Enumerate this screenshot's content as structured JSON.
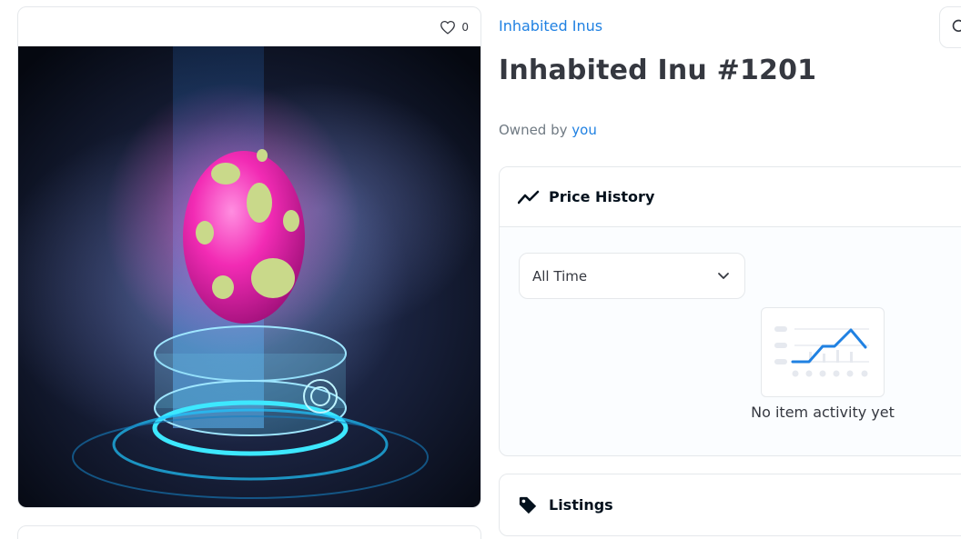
{
  "media": {
    "favorite_count": "0",
    "image_alt": "Pink spotted egg on glowing hologram pedestal"
  },
  "item": {
    "collection_name": "Inhabited Inus",
    "title": "Inhabited Inu #1201",
    "owned_by_prefix": "Owned by",
    "owner": "you"
  },
  "price_history": {
    "title": "Price History",
    "icon": "trend-line-icon",
    "range_selected": "All Time",
    "empty_message": "No item activity yet"
  },
  "listings": {
    "title": "Listings",
    "icon": "tag-icon"
  },
  "colors": {
    "link": "#2081e2",
    "text": "#353840",
    "muted": "#707a83",
    "border": "#e5e8eb",
    "chart_line": "#2081e2"
  }
}
